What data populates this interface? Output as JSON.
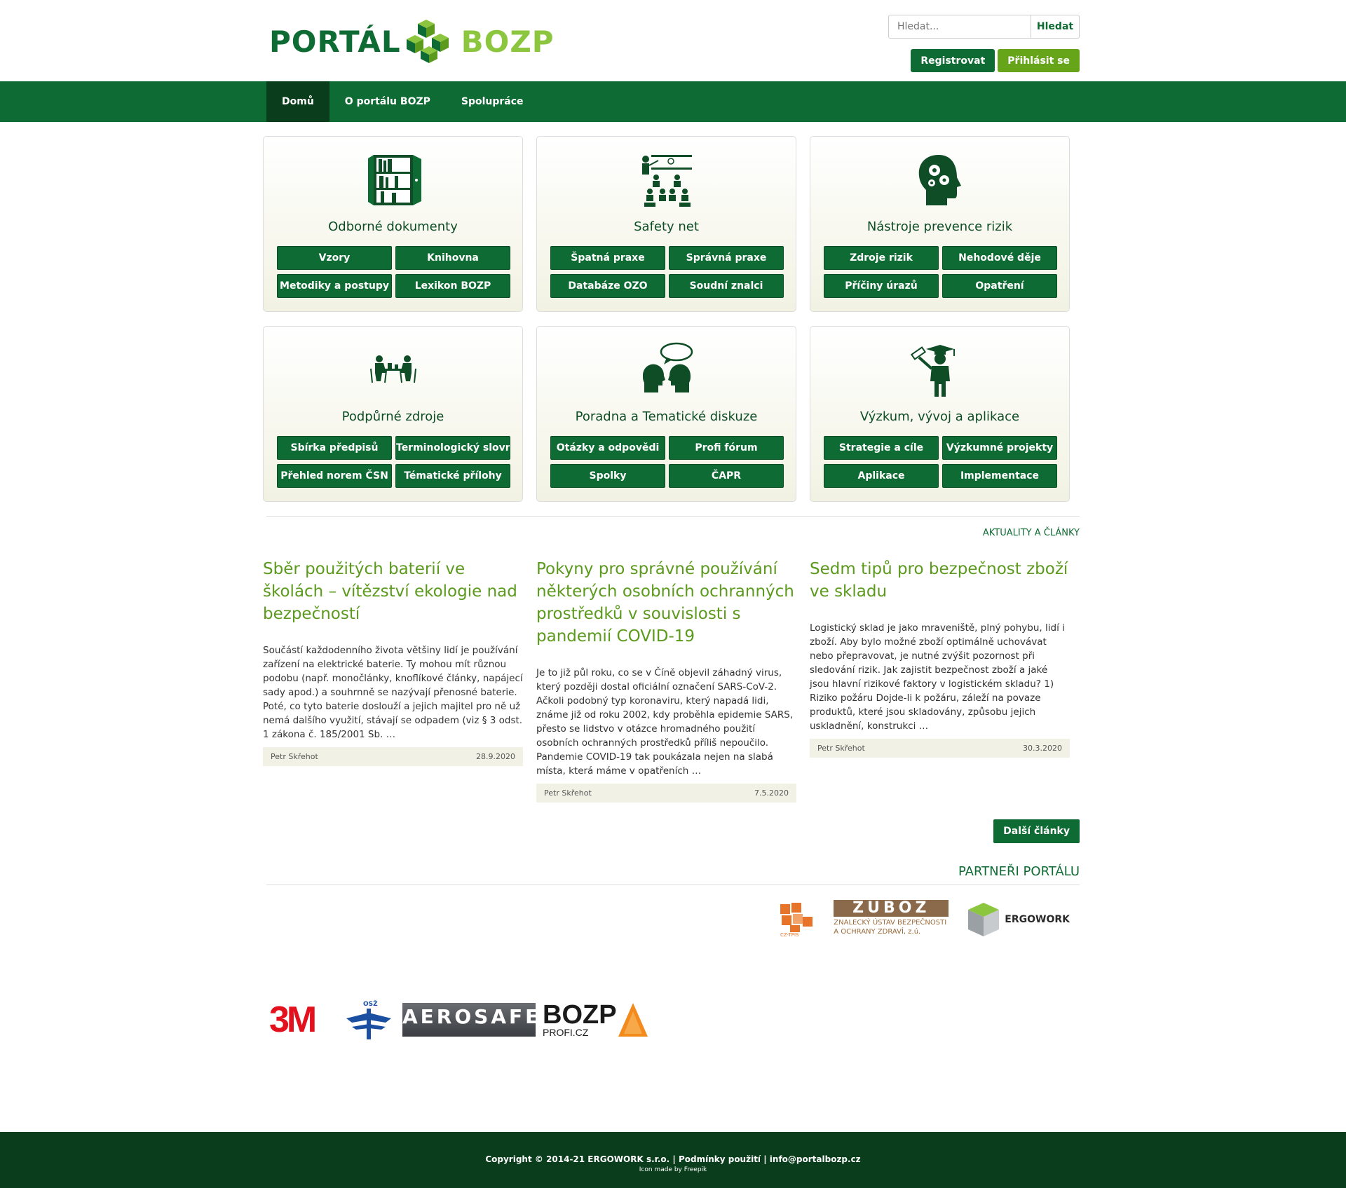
{
  "brand": {
    "logo_left": "PORTÁL",
    "logo_right": "BOZP",
    "green": "#0e6b33",
    "light_green": "#8cc63e"
  },
  "search": {
    "placeholder": "Hledat...",
    "button": "Hledat"
  },
  "auth": {
    "register": "Registrovat",
    "login": "Přihlásit se"
  },
  "nav": {
    "items": [
      {
        "label": "Domů"
      },
      {
        "label": "O portálu BOZP"
      },
      {
        "label": "Spolupráce"
      }
    ]
  },
  "panels": [
    {
      "icon": "bookcase-icon",
      "title": "Odborné dokumenty",
      "buttons": [
        "Vzory",
        "Knihovna",
        "Metodiky a postupy",
        "Lexikon BOZP"
      ]
    },
    {
      "icon": "presentation-icon",
      "title": "Safety net",
      "buttons": [
        "Špatná praxe",
        "Správná praxe",
        "Databáze OZO",
        "Soudní znalci"
      ]
    },
    {
      "icon": "head-gears-icon",
      "title": "Nástroje prevence rizik",
      "buttons": [
        "Zdroje rizik",
        "Nehodové děje",
        "Příčiny úrazů",
        "Opatření"
      ]
    },
    {
      "icon": "meeting-table-icon",
      "title": "Podpůrné zdroje",
      "buttons": [
        "Sbírka předpisů",
        "Terminologický slovník",
        "Přehled norem ČSN",
        "Tématické přílohy"
      ]
    },
    {
      "icon": "dialogue-heads-icon",
      "title": "Poradna a Tematické diskuze",
      "buttons": [
        "Otázky a odpovědi",
        "Profi fórum",
        "Spolky",
        "ČAPR"
      ]
    },
    {
      "icon": "graduate-icon",
      "title": "Výzkum, vývoj a aplikace",
      "buttons": [
        "Strategie a cíle",
        "Výzkumné projekty",
        "Aplikace",
        "Implementace"
      ]
    }
  ],
  "news": {
    "heading": "AKTUALITY A ČLÁNKY",
    "articles": [
      {
        "title": "Sběr použitých baterií ve školách – vítězství ekologie nad bezpečností",
        "excerpt": "Součástí každodenního života většiny lidí je používání zařízení na elektrické baterie. Ty mohou mít různou podobu (např. monočlánky, knoflíkové články, napájecí sady apod.) a souhrnně se nazývají přenosné baterie. Poté, co tyto baterie doslouží a jejich majitel pro ně už nemá dalšího využití, stávají se odpadem (viz § 3 odst. 1 zákona č. 185/2001 Sb. …",
        "author": "Petr Skřehot",
        "date": "28.9.2020"
      },
      {
        "title": "Pokyny pro správné používání některých osobních ochranných prostředků v souvislosti s pandemií COVID-19",
        "excerpt": "Je to již půl roku, co se v Číně objevil záhadný virus, který později dostal oficiální označení SARS-CoV-2. Ačkoli podobný typ koronaviru, který napadá lidi, známe již od roku 2002, kdy proběhla epidemie SARS, přesto se lidstvo v otázce hromadného použití osobních ochranných prostředků příliš nepoučilo. Pandemie COVID-19 tak poukázala nejen na slabá místa, která máme v opatřeních …",
        "author": "Petr Skřehot",
        "date": "7.5.2020"
      },
      {
        "title": "Sedm tipů pro bezpečnost zboží ve skladu",
        "excerpt": "Logistický sklad je jako mraveniště, plný pohybu, lidí i zboží. Aby bylo možné zboží optimálně uchovávat nebo přepravovat, je nutné zvýšit pozornost při sledování rizik. Jak zajistit bezpečnost zboží a jaké jsou hlavní rizikové faktory v logistickém skladu? 1) Riziko požáru Dojde-li k požáru, záleží na povaze produktů, které jsou skladovány, způsobu jejich uskladnění, konstrukci …",
        "author": "Petr Skřehot",
        "date": "30.3.2020"
      }
    ],
    "more": "Další články"
  },
  "partners": {
    "heading": "PARTNEŘI PORTÁLU",
    "logos": {
      "cztpis": "CZ-TPIS",
      "cztpis_url": "www.cztpis.cz",
      "zuboz": "ZÚBOZ",
      "zuboz_sub1": "ZNALECKÝ ÚSTAV BEZPEČNOSTI",
      "zuboz_sub2": "A OCHRANY ZDRAVÍ, z.ú.",
      "ergowork": "ERGOWORK"
    }
  },
  "sponsors": {
    "m3": "3M",
    "osz": "OSŽ",
    "aerosafe": "AEROSAFE",
    "bozp": "BOZP",
    "bozp_sub": "PROFI.CZ"
  },
  "footer": {
    "copyright": "Copyright © 2014-21 ERGOWORK s.r.o. | Podmínky použití | info@portalbozp.cz",
    "credit": "Icon made by Freepik"
  }
}
